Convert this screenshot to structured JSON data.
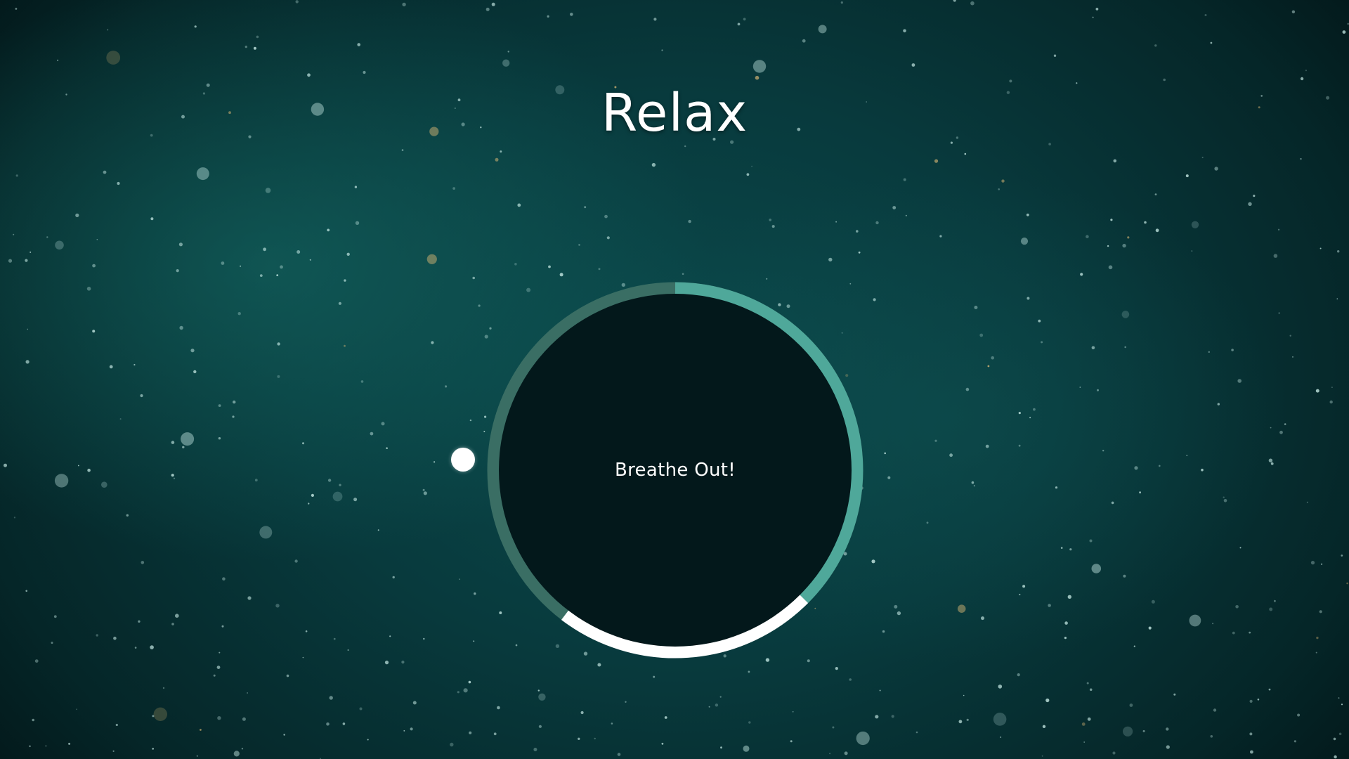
{
  "app": {
    "title": "Relax",
    "status": "Breathe Out!"
  },
  "colors": {
    "background": "#083a3d",
    "ring_track": "#3a6e64",
    "ring_active": "#4fa89a",
    "ring_exhale": "#ffffff",
    "circle_fill": "#03181b"
  },
  "icons": {
    "pointer": "dot-indicator"
  }
}
